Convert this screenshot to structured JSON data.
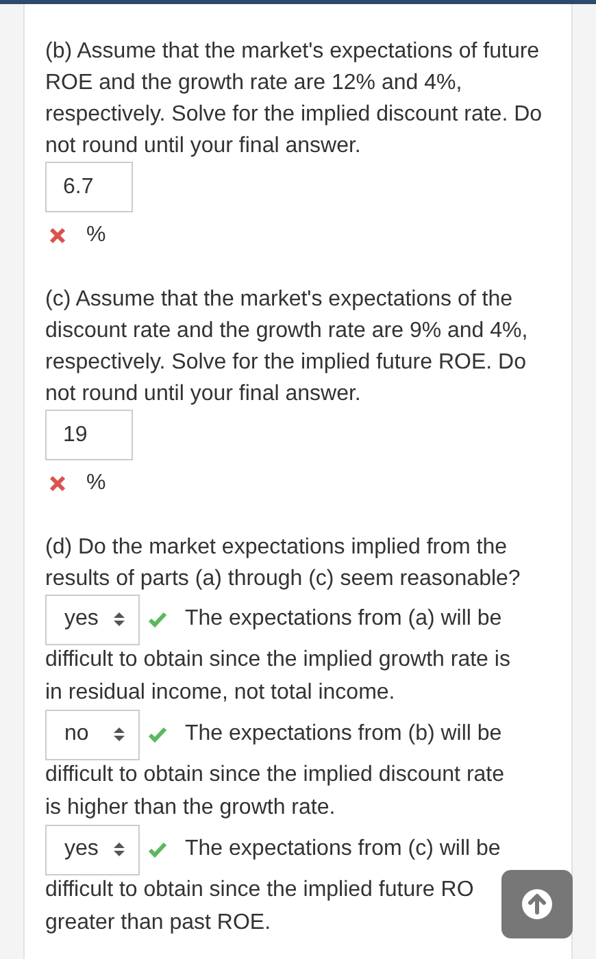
{
  "parts": [
    {
      "kind": "numeric",
      "prompt": "(b) Assume that the market's expectations of future ROE and the growth rate are 12% and 4%, respectively. Solve for the implied discount rate.  Do not round until your final answer.",
      "answer": "6.7",
      "correct": false,
      "unit": "%"
    },
    {
      "kind": "numeric",
      "prompt": "(c) Assume that the market's expectations of the discount rate and the growth rate are 9% and 4%, respectively. Solve for the implied future ROE.  Do not round until your final answer.",
      "answer": "19",
      "correct": false,
      "unit": "%"
    },
    {
      "kind": "dropdowns",
      "prompt": "(d) Do the market expectations implied from the results of parts (a) through (c) seem reasonable?",
      "items": [
        {
          "value": "yes",
          "correct": true,
          "lead": "The expectations from (a) will be",
          "lines": [
            "difficult to obtain since the implied growth rate is",
            "in residual income, not total income."
          ]
        },
        {
          "value": "no",
          "correct": true,
          "lead": "The expectations from (b) will be",
          "lines": [
            "difficult to obtain since the implied discount rate",
            "is higher than the growth rate."
          ]
        },
        {
          "value": "yes",
          "correct": true,
          "lead": "The expectations from (c) will be",
          "lines": [
            "difficult to obtain since the implied future RO",
            "greater than past ROE."
          ]
        }
      ]
    }
  ]
}
